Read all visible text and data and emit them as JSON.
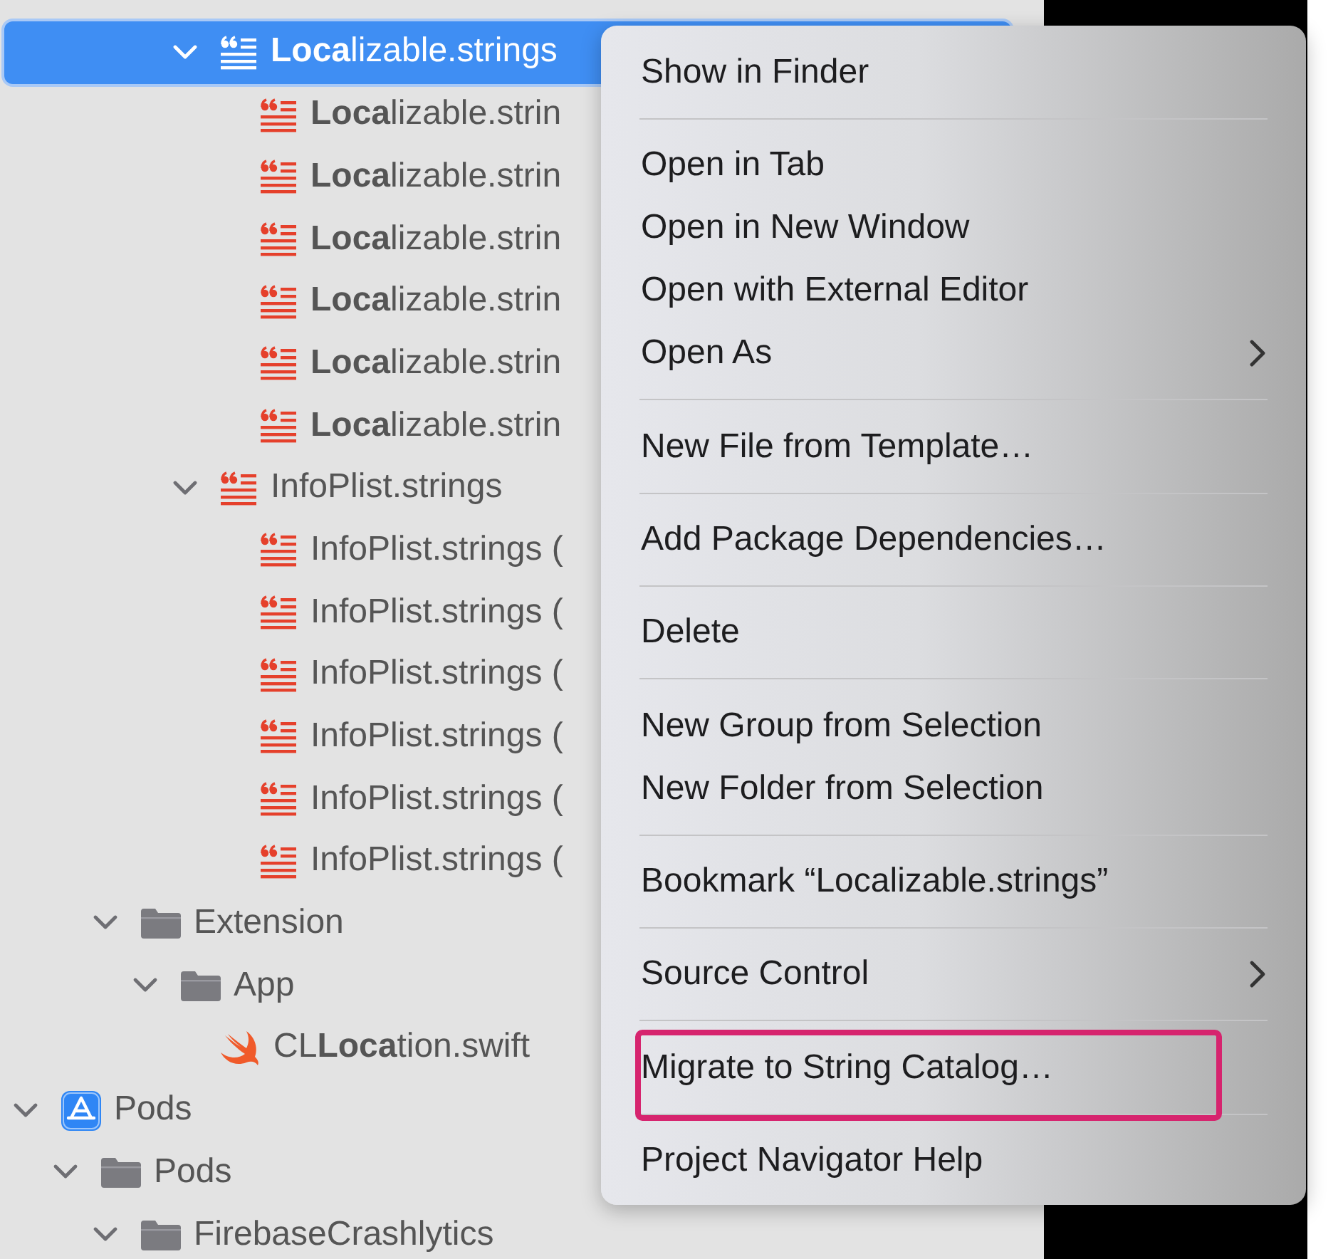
{
  "navigator": {
    "tree": [
      {
        "children": [
          {
            "children": [
              {
                "children": [
                  {
                    "children": [
                      {
                        "label": "**Loca**lizable.strings",
                        "kind": "strings",
                        "expanded": true,
                        "selected": true,
                        "children": [
                          {
                            "label": "**Loca**lizable.strin",
                            "kind": "strings",
                            "selected": false
                          },
                          {
                            "label": "**Loca**lizable.strin",
                            "kind": "strings",
                            "selected": false
                          },
                          {
                            "label": "**Loca**lizable.strin",
                            "kind": "strings",
                            "selected": false
                          },
                          {
                            "label": "**Loca**lizable.strin",
                            "kind": "strings",
                            "selected": false
                          },
                          {
                            "label": "**Loca**lizable.strin",
                            "kind": "strings",
                            "selected": false
                          },
                          {
                            "label": "**Loca**lizable.strin",
                            "kind": "strings",
                            "selected": false
                          }
                        ]
                      },
                      {
                        "label": "InfoPlist.strings",
                        "kind": "strings",
                        "expanded": true,
                        "selected": false,
                        "children": [
                          {
                            "label": "InfoPlist.strings (",
                            "kind": "strings",
                            "selected": false
                          },
                          {
                            "label": "InfoPlist.strings (",
                            "kind": "strings",
                            "selected": false
                          },
                          {
                            "label": "InfoPlist.strings (",
                            "kind": "strings",
                            "selected": false
                          },
                          {
                            "label": "InfoPlist.strings (",
                            "kind": "strings",
                            "selected": false
                          },
                          {
                            "label": "InfoPlist.strings (",
                            "kind": "strings",
                            "selected": false
                          },
                          {
                            "label": "InfoPlist.strings (",
                            "kind": "strings",
                            "selected": false
                          }
                        ]
                      }
                    ]
                  }
                ]
              },
              {
                "label": "Extension",
                "kind": "folder",
                "expanded": true,
                "selected": false,
                "children": [
                  {
                    "label": "App",
                    "kind": "folder",
                    "expanded": true,
                    "selected": false,
                    "children": [
                      {
                        "label": "CL**Loca**tion.swift",
                        "kind": "swift",
                        "selected": false
                      }
                    ]
                  }
                ]
              }
            ]
          }
        ]
      },
      {
        "label": "Pods",
        "kind": "project",
        "expanded": true,
        "selected": false,
        "children": [
          {
            "label": "Pods",
            "kind": "folder",
            "expanded": true,
            "selected": false,
            "children": [
              {
                "label": "FirebaseCrashlytics",
                "kind": "folder",
                "expanded": true,
                "selected": false
              }
            ]
          }
        ]
      }
    ]
  },
  "context_menu": {
    "groups": [
      [
        {
          "label": "Show in Finder",
          "submenu": false,
          "outlined": false
        }
      ],
      [
        {
          "label": "Open in Tab",
          "submenu": false,
          "outlined": false
        },
        {
          "label": "Open in New Window",
          "submenu": false,
          "outlined": false
        },
        {
          "label": "Open with External Editor",
          "submenu": false,
          "outlined": false
        },
        {
          "label": "Open As",
          "submenu": true,
          "outlined": false
        }
      ],
      [
        {
          "label": "New File from Template…",
          "submenu": false,
          "outlined": false
        }
      ],
      [
        {
          "label": "Add Package Dependencies…",
          "submenu": false,
          "outlined": false
        }
      ],
      [
        {
          "label": "Delete",
          "submenu": false,
          "outlined": false
        }
      ],
      [
        {
          "label": "New Group from Selection",
          "submenu": false,
          "outlined": false
        },
        {
          "label": "New Folder from Selection",
          "submenu": false,
          "outlined": false
        }
      ],
      [
        {
          "label": "Bookmark “Localizable.strings”",
          "submenu": false,
          "outlined": false
        }
      ],
      [
        {
          "label": "Source Control",
          "submenu": true,
          "outlined": false
        }
      ],
      [
        {
          "label": "Migrate to String Catalog…",
          "submenu": false,
          "outlined": true
        }
      ],
      [
        {
          "label": "Project Navigator Help",
          "submenu": false,
          "outlined": false
        }
      ]
    ]
  }
}
